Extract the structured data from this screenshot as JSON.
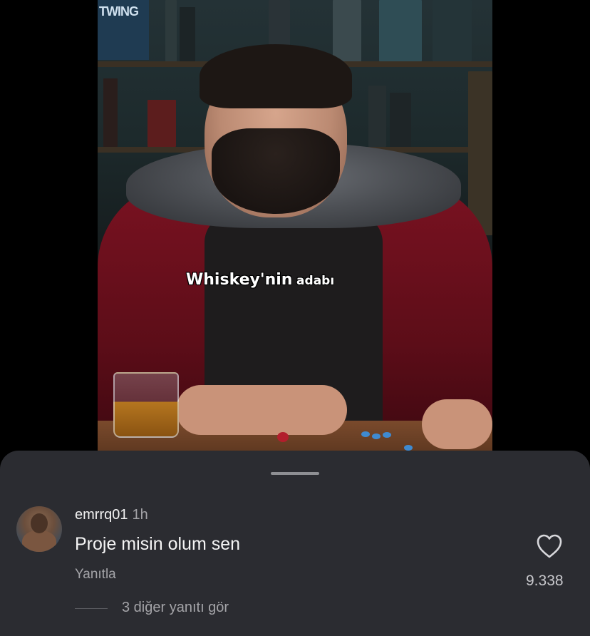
{
  "video": {
    "caption_main": "Whiskey'nin",
    "caption_small": "adabı",
    "poster_text": "TWING"
  },
  "comment": {
    "username": "emrrq01",
    "time": "1h",
    "text": "Proje misin olum sen",
    "reply_label": "Yanıtla",
    "like_count": "9.338",
    "more_replies": "3 diğer yanıtı gör"
  },
  "colors": {
    "sheet_bg": "#2b2c31",
    "secondary_text": "#a4a4a8",
    "primary_text": "#f5f5f5"
  },
  "icons": {
    "like": "heart-outline-icon"
  }
}
